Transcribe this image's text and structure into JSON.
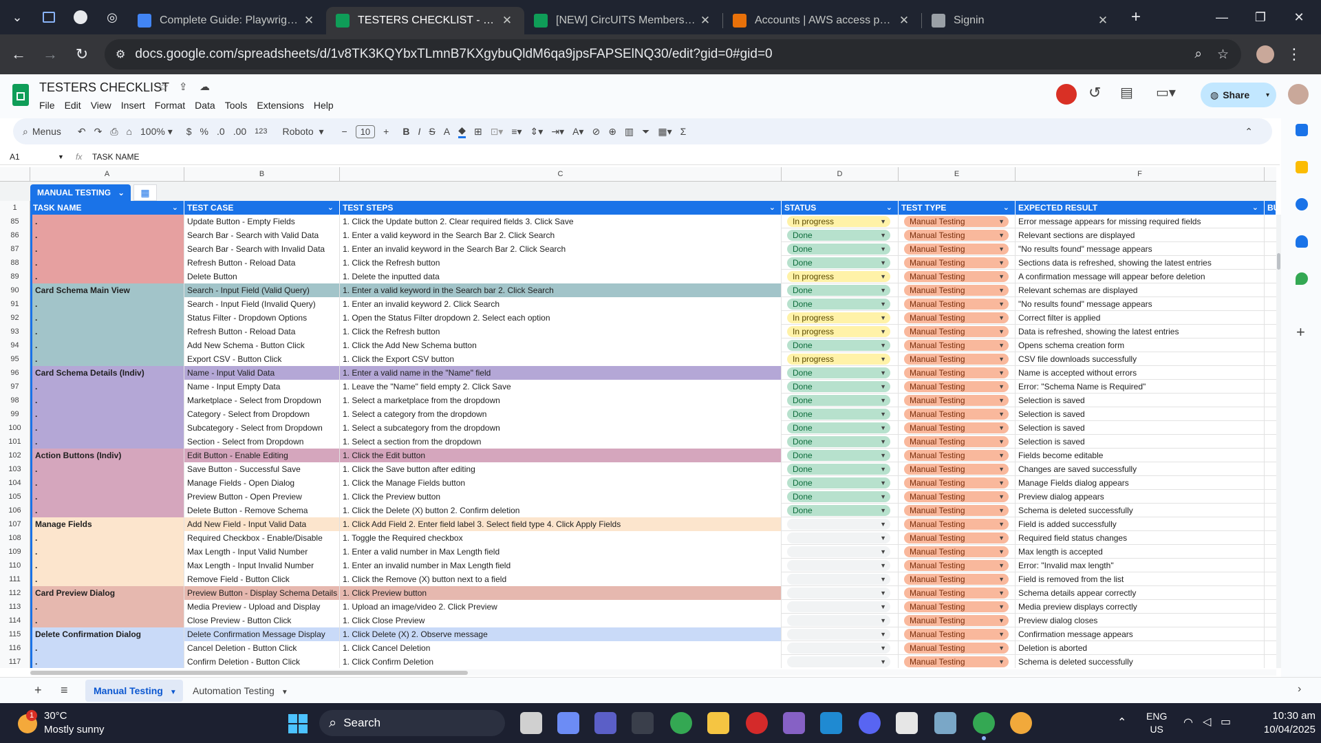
{
  "browser": {
    "tabs": [
      {
        "title": "Complete Guide: Playwright T",
        "color": "#4285f4"
      },
      {
        "title": "TESTERS CHECKLIST - Google",
        "color": "#0f9d58",
        "active": true
      },
      {
        "title": "[NEW] CircUITS Membership",
        "color": "#0f9d58"
      },
      {
        "title": "Accounts | AWS access portal",
        "color": "#e8710a"
      },
      {
        "title": "Signin",
        "color": "#9aa0a6"
      }
    ],
    "url": "docs.google.com/spreadsheets/d/1v8TK3KQYbxTLmnB7KXgybuQldM6qa9jpsFAPSElNQ30/edit?gid=0#gid=0"
  },
  "sheet": {
    "title": "TESTERS CHECKLIST",
    "menus": [
      "File",
      "Edit",
      "View",
      "Insert",
      "Format",
      "Data",
      "Tools",
      "Extensions",
      "Help"
    ],
    "share_label": "Share",
    "toolbar": {
      "menus": "Menus",
      "zoom": "100%",
      "currency": "$",
      "percent": "%",
      "dec_less": ".0",
      "dec_more": ".00",
      "format123": "123",
      "font": "Roboto",
      "font_size": "10"
    },
    "cell_ref": "A1",
    "formula": "TASK NAME",
    "table_name": "MANUAL TESTING",
    "col_letters": [
      "A",
      "B",
      "C",
      "D",
      "E",
      "F"
    ],
    "headers": [
      "TASK NAME",
      "TEST CASE",
      "TEST STEPS",
      "STATUS",
      "TEST TYPE",
      "EXPECTED RESULT",
      "BU"
    ],
    "header_row_num": "1",
    "rows": [
      {
        "n": "85",
        "a": ".",
        "b": "Update Button - Empty Fields",
        "c": "1. Click the Update button  2. Clear required fields  3. Click Save",
        "d": "In progress",
        "e": "Manual Testing",
        "f": "Error message appears for missing required fields",
        "color": "#e6a0a0"
      },
      {
        "n": "86",
        "a": ".",
        "b": "Search Bar - Search with Valid Data",
        "c": "1. Enter a valid keyword in the Search Bar  2. Click Search",
        "d": "Done",
        "e": "Manual Testing",
        "f": "Relevant sections are displayed",
        "color": "#e6a0a0"
      },
      {
        "n": "87",
        "a": ".",
        "b": "Search Bar - Search with Invalid Data",
        "c": "1. Enter an invalid keyword in the Search Bar  2. Click Search",
        "d": "Done",
        "e": "Manual Testing",
        "f": "\"No results found\" message appears",
        "color": "#e6a0a0"
      },
      {
        "n": "88",
        "a": ".",
        "b": "Refresh Button - Reload Data",
        "c": "1. Click the Refresh button",
        "d": "Done",
        "e": "Manual Testing",
        "f": "Sections data is refreshed, showing the latest entries",
        "color": "#e6a0a0"
      },
      {
        "n": "89",
        "a": ".",
        "b": "Delete Button",
        "c": "1. Delete the inputted data",
        "d": "In progress",
        "e": "Manual Testing",
        "f": "A confirmation message will appear before deletion",
        "color": "#e6a0a0"
      },
      {
        "n": "90",
        "a": "Card Schema Main View",
        "b": "Search - Input Field (Valid Query)",
        "c": "1. Enter a valid keyword in the Search bar  2. Click Search",
        "d": "Done",
        "e": "Manual Testing",
        "f": "Relevant schemas are displayed",
        "color": "#a2c4c9",
        "hl": true
      },
      {
        "n": "91",
        "a": ".",
        "b": "Search - Input Field (Invalid Query)",
        "c": "1. Enter an invalid keyword  2. Click Search",
        "d": "Done",
        "e": "Manual Testing",
        "f": "\"No results found\" message appears",
        "color": "#a2c4c9"
      },
      {
        "n": "92",
        "a": ".",
        "b": "Status Filter - Dropdown Options",
        "c": "1. Open the Status Filter dropdown  2. Select each option",
        "d": "In progress",
        "e": "Manual Testing",
        "f": "Correct filter is applied",
        "color": "#a2c4c9"
      },
      {
        "n": "93",
        "a": ".",
        "b": "Refresh Button - Reload Data",
        "c": "1. Click the Refresh button",
        "d": "In progress",
        "e": "Manual Testing",
        "f": "Data is refreshed, showing the latest entries",
        "color": "#a2c4c9"
      },
      {
        "n": "94",
        "a": ".",
        "b": "Add New Schema - Button Click",
        "c": "1. Click the Add New Schema button",
        "d": "Done",
        "e": "Manual Testing",
        "f": "Opens schema creation form",
        "color": "#a2c4c9"
      },
      {
        "n": "95",
        "a": ".",
        "b": "Export CSV - Button Click",
        "c": "1. Click the Export CSV button",
        "d": "In progress",
        "e": "Manual Testing",
        "f": "CSV file downloads successfully",
        "color": "#a2c4c9"
      },
      {
        "n": "96",
        "a": "Card Schema Details (Indiv)",
        "b": "Name - Input Valid Data",
        "c": "1. Enter a valid name in the \"Name\" field",
        "d": "Done",
        "e": "Manual Testing",
        "f": "Name is accepted without errors",
        "color": "#b4a7d6",
        "hl": true
      },
      {
        "n": "97",
        "a": ".",
        "b": "Name - Input Empty Data",
        "c": "1. Leave the \"Name\" field empty  2. Click Save",
        "d": "Done",
        "e": "Manual Testing",
        "f": "Error: \"Schema Name is Required\"",
        "color": "#b4a7d6"
      },
      {
        "n": "98",
        "a": ".",
        "b": "Marketplace - Select from Dropdown",
        "c": "1. Select a marketplace from the dropdown",
        "d": "Done",
        "e": "Manual Testing",
        "f": "Selection is saved",
        "color": "#b4a7d6"
      },
      {
        "n": "99",
        "a": ".",
        "b": "Category - Select from Dropdown",
        "c": "1. Select a category from the dropdown",
        "d": "Done",
        "e": "Manual Testing",
        "f": "Selection is saved",
        "color": "#b4a7d6"
      },
      {
        "n": "100",
        "a": ".",
        "b": "Subcategory - Select from Dropdown",
        "c": "1. Select a subcategory from the dropdown",
        "d": "Done",
        "e": "Manual Testing",
        "f": "Selection is saved",
        "color": "#b4a7d6"
      },
      {
        "n": "101",
        "a": ".",
        "b": "Section - Select from Dropdown",
        "c": "1. Select a section from the dropdown",
        "d": "Done",
        "e": "Manual Testing",
        "f": "Selection is saved",
        "color": "#b4a7d6"
      },
      {
        "n": "102",
        "a": "Action Buttons (Indiv)",
        "b": "Edit Button - Enable Editing",
        "c": "1. Click the Edit button",
        "d": "Done",
        "e": "Manual Testing",
        "f": "Fields become editable",
        "color": "#d5a6bd",
        "hl": true
      },
      {
        "n": "103",
        "a": ".",
        "b": "Save Button - Successful Save",
        "c": "1. Click the Save button after editing",
        "d": "Done",
        "e": "Manual Testing",
        "f": "Changes are saved successfully",
        "color": "#d5a6bd"
      },
      {
        "n": "104",
        "a": ".",
        "b": "Manage Fields - Open Dialog",
        "c": "1. Click the Manage Fields button",
        "d": "Done",
        "e": "Manual Testing",
        "f": "Manage Fields dialog appears",
        "color": "#d5a6bd"
      },
      {
        "n": "105",
        "a": ".",
        "b": "Preview Button - Open Preview",
        "c": "1. Click the Preview button",
        "d": "Done",
        "e": "Manual Testing",
        "f": "Preview dialog appears",
        "color": "#d5a6bd"
      },
      {
        "n": "106",
        "a": ".",
        "b": "Delete Button - Remove Schema",
        "c": "1. Click the Delete (X) button  2. Confirm deletion",
        "d": "Done",
        "e": "Manual Testing",
        "f": "Schema is deleted successfully",
        "color": "#d5a6bd"
      },
      {
        "n": "107",
        "a": "Manage Fields",
        "b": "Add New Field - Input Valid Data",
        "c": "1. Click Add Field 2. Enter field label 3. Select field type 4. Click Apply Fields",
        "d": "",
        "e": "Manual Testing",
        "f": "Field is added successfully",
        "color": "#fce5cd",
        "hl": true
      },
      {
        "n": "108",
        "a": ".",
        "b": "Required Checkbox - Enable/Disable",
        "c": "1. Toggle the Required checkbox",
        "d": "",
        "e": "Manual Testing",
        "f": "Required field status changes",
        "color": "#fce5cd"
      },
      {
        "n": "109",
        "a": ".",
        "b": "Max Length - Input Valid Number",
        "c": "1. Enter a valid number in Max Length field",
        "d": "",
        "e": "Manual Testing",
        "f": "Max length is accepted",
        "color": "#fce5cd"
      },
      {
        "n": "110",
        "a": ".",
        "b": "Max Length - Input Invalid Number",
        "c": "1. Enter an invalid number in Max Length field",
        "d": "",
        "e": "Manual Testing",
        "f": "Error: \"Invalid max length\"",
        "color": "#fce5cd"
      },
      {
        "n": "111",
        "a": ".",
        "b": "Remove Field - Button Click",
        "c": "1. Click the Remove (X) button next to a field",
        "d": "",
        "e": "Manual Testing",
        "f": "Field is removed from the list",
        "color": "#fce5cd"
      },
      {
        "n": "112",
        "a": "Card Preview Dialog",
        "b": "Preview Button - Display Schema Details",
        "c": "1. Click Preview button",
        "d": "",
        "e": "Manual Testing",
        "f": "Schema details appear correctly",
        "color": "#e6b8af",
        "hl": true
      },
      {
        "n": "113",
        "a": ".",
        "b": "Media Preview - Upload and Display",
        "c": "1. Upload an image/video  2. Click Preview",
        "d": "",
        "e": "Manual Testing",
        "f": "Media preview displays correctly",
        "color": "#e6b8af"
      },
      {
        "n": "114",
        "a": ".",
        "b": "Close Preview - Button Click",
        "c": "1. Click Close Preview",
        "d": "",
        "e": "Manual Testing",
        "f": "Preview dialog closes",
        "color": "#e6b8af"
      },
      {
        "n": "115",
        "a": "Delete Confirmation Dialog",
        "b": "Delete Confirmation Message Display",
        "c": "1. Click Delete (X)  2. Observe message",
        "d": "",
        "e": "Manual Testing",
        "f": "Confirmation message appears",
        "color": "#c9daf8",
        "hl": true
      },
      {
        "n": "116",
        "a": ".",
        "b": "Cancel Deletion - Button Click",
        "c": "1. Click Cancel Deletion",
        "d": "",
        "e": "Manual Testing",
        "f": "Deletion is aborted",
        "color": "#c9daf8"
      },
      {
        "n": "117",
        "a": ".",
        "b": "Confirm Deletion - Button Click",
        "c": "1. Click Confirm Deletion",
        "d": "",
        "e": "Manual Testing",
        "f": "Schema is deleted successfully",
        "color": "#c9daf8"
      }
    ],
    "sheet_tabs": [
      "Manual Testing",
      "Automation Testing"
    ]
  },
  "taskbar": {
    "temp": "30°C",
    "weather": "Mostly sunny",
    "weather_badge": "1",
    "search": "Search",
    "lang": "ENG",
    "region": "US",
    "time": "10:30 am",
    "date": "10/04/2025"
  }
}
